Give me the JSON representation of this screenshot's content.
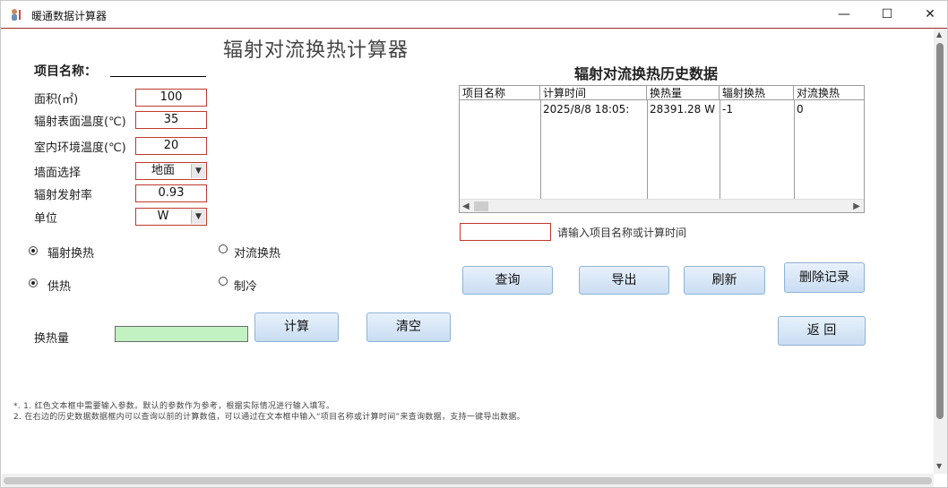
{
  "window": {
    "title": "暖通数据计算器",
    "min_icon": "minimize-icon",
    "max_icon": "maximize-icon",
    "close_icon": "close-icon"
  },
  "form": {
    "main_title": "辐射对流换热计算器",
    "project_label": "项目名称：",
    "area_label": "面积(㎡)",
    "area_value": "100",
    "surface_temp_label": "辐射表面温度(℃)",
    "surface_temp_value": "35",
    "indoor_temp_label": "室内环境温度(℃)",
    "indoor_temp_value": "20",
    "wall_label": "墙面选择",
    "wall_value": "地面",
    "emissivity_label": "辐射发射率",
    "emissivity_value": "0.93",
    "unit_label": "单位",
    "unit_value": "W",
    "radio_radiation": "辐射换热",
    "radio_convection": "对流换热",
    "radio_heating": "供热",
    "radio_cooling": "制冷",
    "result_label": "换热量",
    "calc_button": "计算",
    "clear_button": "清空"
  },
  "history": {
    "title": "辐射对流换热历史数据",
    "columns": [
      "项目名称",
      "计算时间",
      "换热量",
      "辐射换热",
      "对流换热"
    ],
    "rows": [
      [
        "",
        "2025/8/8 18:05:",
        "28391.28 W",
        "-1",
        "0"
      ]
    ],
    "search_hint": "请输入项目名称或计算时间",
    "query_button": "查询",
    "export_button": "导出",
    "refresh_button": "刷新",
    "delete_button": "删除记录",
    "back_button": "返 回"
  },
  "notes": {
    "line1": "*. 1. 红色文本框中需要输入参数。默认的参数作为参考，根据实际情况进行输入填写。",
    "line2": "2. 在右边的历史数据数据框内可以查询以前的计算数值，可以通过在文本框中输入“项目名称或计算时间”来查询数据，支持一键导出数据。"
  },
  "colors": {
    "required_border": "#c0392b",
    "result_fill": "#c2f2c2",
    "button_fill": "#c9ddf2"
  }
}
